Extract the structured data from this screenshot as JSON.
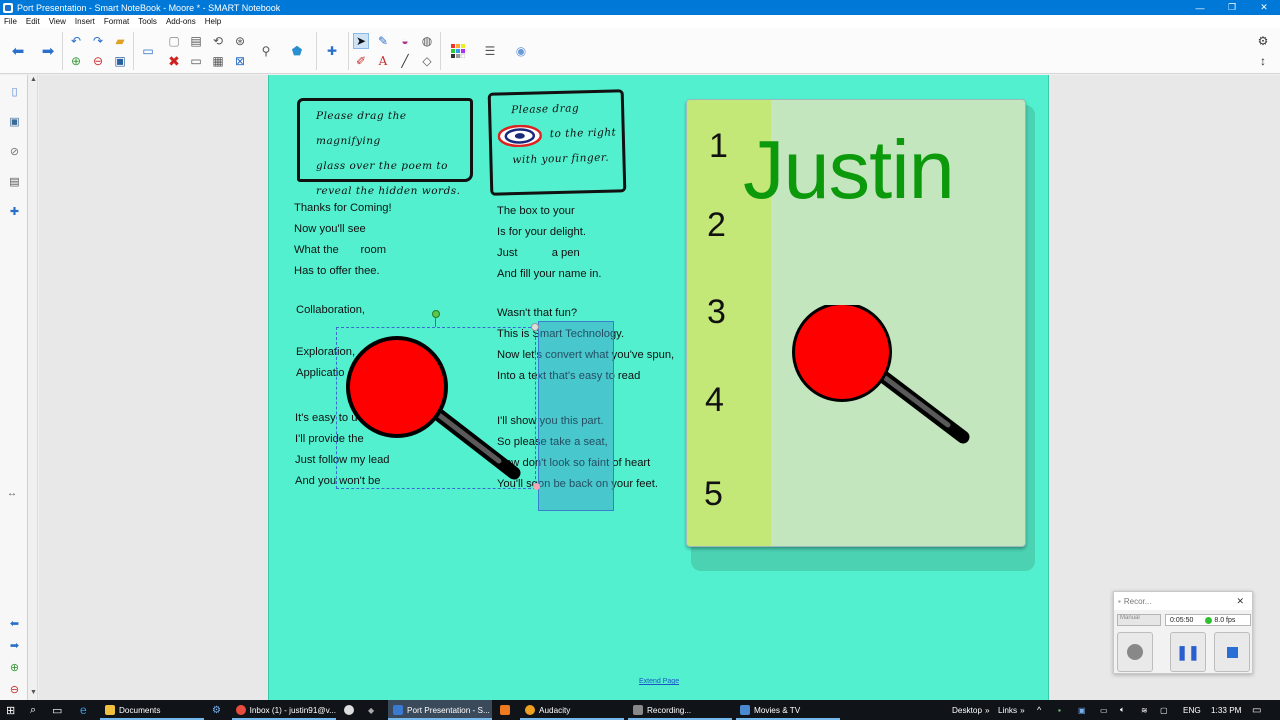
{
  "window": {
    "title": "Port Presentation - Smart NoteBook - Moore * - SMART Notebook",
    "minimize": "—",
    "maximize": "❐",
    "close": "✕"
  },
  "menu": [
    "File",
    "Edit",
    "View",
    "Insert",
    "Format",
    "Tools",
    "Add-ons",
    "Help"
  ],
  "slide": {
    "box1_lines": [
      "Please drag the magnifying",
      "glass over the poem to",
      "reveal the hidden words."
    ],
    "box2_line1": "Please drag",
    "box2_line1b": "to the right",
    "box2_line2": "with your finger.",
    "poem_left_1": [
      "Thanks for Coming!",
      "Now you'll see",
      "What the       room",
      "Has to offer thee."
    ],
    "poem_left_2a": "Collaboration,",
    "poem_left_2b": [
      "Exploration,",
      "Applicatio"
    ],
    "poem_left_3": [
      "It's easy to u",
      "I'll provide the",
      "Just follow my lead",
      "And you won't be"
    ],
    "poem_right_1": [
      "The box to your",
      "Is for your delight.",
      "Just           a pen",
      "And fill your name in."
    ],
    "poem_right_2": [
      "Wasn't that fun?",
      "This is Smart Technology.",
      "Now let's convert what you've spun,",
      "Into a text that's easy to read"
    ],
    "poem_right_3": [
      "I'll show you this part.",
      "So please take a seat,",
      "Now don't look so faint of heart",
      "You'll soon be back on your feet."
    ],
    "extend_page": "Extend Page",
    "card_numbers": [
      "1",
      "2",
      "3",
      "4",
      "5"
    ],
    "card_name": "Justin"
  },
  "recorder": {
    "title": "Recor...",
    "mode": "Manual",
    "time": "0:05:50",
    "fps": "8.0 fps"
  },
  "taskbar": {
    "items": [
      "Documents",
      "Inbox (1) - justin91@v...",
      "Port Presentation - S...",
      "Audacity",
      "Recording...",
      "Movies & TV"
    ],
    "desktop": "Desktop",
    "links": "Links",
    "lang": "ENG",
    "clock": "1:33 PM"
  },
  "colors": {
    "page_bg": "#52f0cf",
    "accent": "#0078d7",
    "name_green": "#0c9a0c",
    "magnifier_red": "#ff0000"
  }
}
